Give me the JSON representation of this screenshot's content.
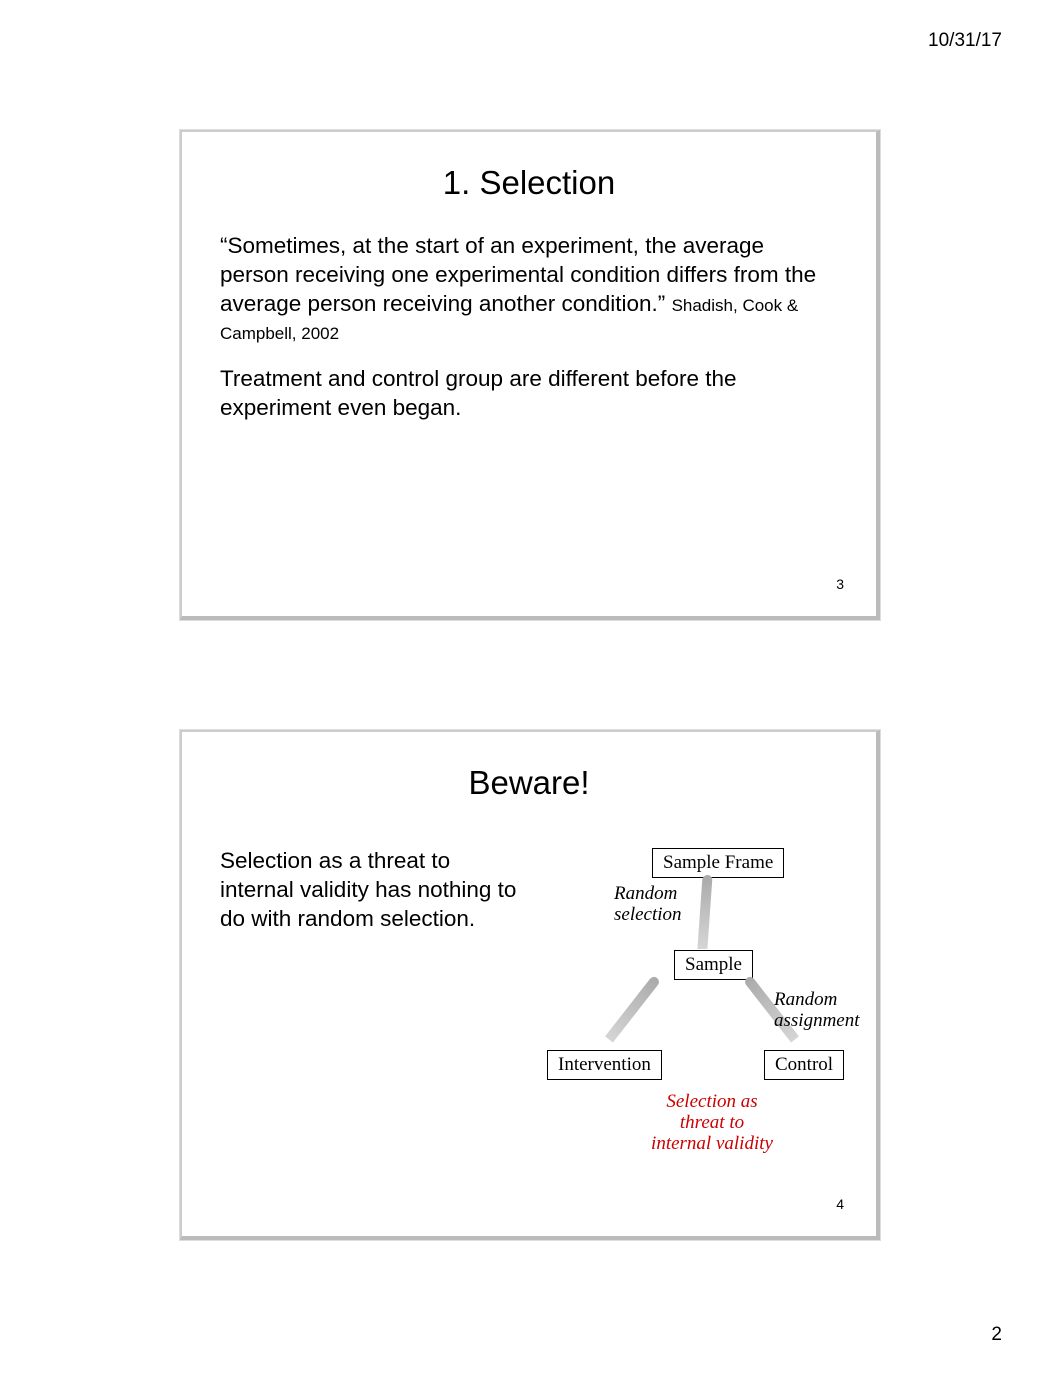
{
  "page": {
    "date": "10/31/17",
    "number": "2"
  },
  "slide1": {
    "title": "1. Selection",
    "quote_open": "“",
    "quote_body": "Sometimes, at the start of an experiment, the average person receiving one experimental condition differs from the average person receiving another condition.",
    "quote_close": "”",
    "citation": "Shadish, Cook & Campbell, 2002",
    "para2": "Treatment and control group are different before the experiment even began.",
    "slide_number": "3"
  },
  "slide2": {
    "title": "Beware!",
    "left_text": "Selection as a threat to internal validity has nothing to do with random selection.",
    "diagram": {
      "sample_frame": "Sample Frame",
      "random_selection": "Random\nselection",
      "sample": "Sample",
      "random_assignment": "Random\nassignment",
      "intervention": "Intervention",
      "control": "Control",
      "threat": "Selection as\nthreat to\ninternal validity"
    },
    "slide_number": "4"
  }
}
